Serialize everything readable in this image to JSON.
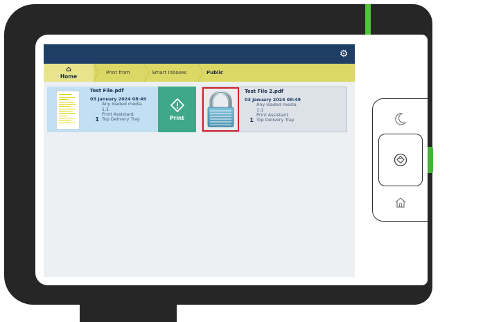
{
  "breadcrumb": {
    "home": "Home",
    "items": [
      "Print from",
      "Smart Inboxes",
      "Public"
    ]
  },
  "jobs": [
    {
      "name": "Test File.pdf",
      "datetime": "03 January 2024 08:49",
      "media": "Any loaded media",
      "scale": "1:1",
      "workflow": "Print Assistant",
      "copies": "1",
      "tray": "Top Delivery Tray",
      "action_label": "Print"
    },
    {
      "name": "Test File 2.pdf",
      "datetime": "03 January 2024 08:49",
      "media": "Any loaded media",
      "scale": "1:1",
      "workflow": "Print Assistant",
      "copies": "1",
      "tray": "Top Delivery Tray"
    }
  ],
  "icons": {
    "settings": "gear-icon",
    "home": "home-icon",
    "print": "print-diamond-icon",
    "lock": "lock-icon",
    "sleep": "moon-icon",
    "stop": "stop-icon",
    "hw_home": "home-outline-icon"
  },
  "colors": {
    "topbar": "#1f3e66",
    "breadcrumb": "#dcd865",
    "print_button": "#3fa88a",
    "selected_job": "#c2dff3",
    "lock_highlight": "#d3232b",
    "status_led": "#52c33b"
  }
}
